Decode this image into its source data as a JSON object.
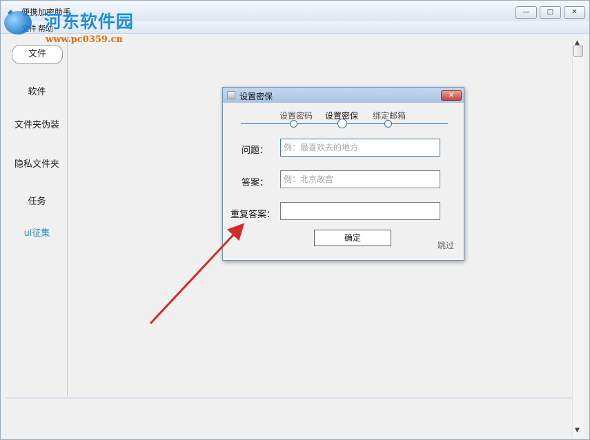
{
  "window": {
    "title": "便携加密助手",
    "menu": [
      "文件",
      "帮助"
    ],
    "controls": {
      "minimize": "—",
      "maximize": "□",
      "close": "✕"
    }
  },
  "watermark": {
    "title": "河东软件园",
    "url": "www.pc0359.cn"
  },
  "sidebar": {
    "items": [
      {
        "label": "文件",
        "active": true
      },
      {
        "label": "软件"
      },
      {
        "label": "文件夹伪装"
      },
      {
        "label": "隐私文件夹"
      },
      {
        "label": "任务"
      },
      {
        "label": "ui征集",
        "style": "link"
      }
    ]
  },
  "dialog": {
    "title": "设置密保",
    "close_glyph": "✕",
    "steps": [
      {
        "label": "设置密码"
      },
      {
        "label": "设置密保",
        "current": true
      },
      {
        "label": "绑定邮箱"
      }
    ],
    "fields": [
      {
        "label": "问题：",
        "value": "",
        "placeholder": "例：最喜欢去的地方"
      },
      {
        "label": "答案：",
        "value": "",
        "placeholder": "例：北京故宫"
      },
      {
        "label": "重复答案：",
        "value": "",
        "placeholder": ""
      }
    ],
    "confirm_label": "确定",
    "skip_label": "跳过"
  },
  "colors": {
    "accent": "#2a6fb3",
    "link": "#1f8fcf",
    "annotation_arrow": "#d42a2a",
    "dialog_close": "#c5473a"
  },
  "icons": [
    "app-icon",
    "dialog-icon",
    "minimize-icon",
    "maximize-icon",
    "close-icon",
    "scroll-up-icon",
    "scroll-down-icon"
  ]
}
